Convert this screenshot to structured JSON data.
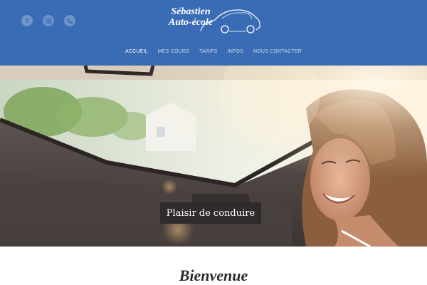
{
  "social": [
    {
      "icon": "facebook-icon",
      "glyph": "f"
    },
    {
      "icon": "instagram-icon",
      "glyph": ""
    },
    {
      "icon": "phone-icon",
      "glyph": ""
    }
  ],
  "logo": {
    "line1": "Sébastien",
    "line2": "Auto-école"
  },
  "nav": {
    "items": [
      {
        "label": "ACCUEIL",
        "active": true
      },
      {
        "label": "MES COURS",
        "active": false
      },
      {
        "label": "TARIFS",
        "active": false
      },
      {
        "label": "INFOS",
        "active": false
      },
      {
        "label": "NOUS CONTACTER",
        "active": false
      }
    ]
  },
  "hero": {
    "caption": "Plaisir de conduire"
  },
  "welcome": {
    "title": "Bienvenue"
  },
  "colors": {
    "header": "#3a6bb5",
    "caption_bg": "#2f2b2c",
    "text": "#2a2a2a"
  }
}
